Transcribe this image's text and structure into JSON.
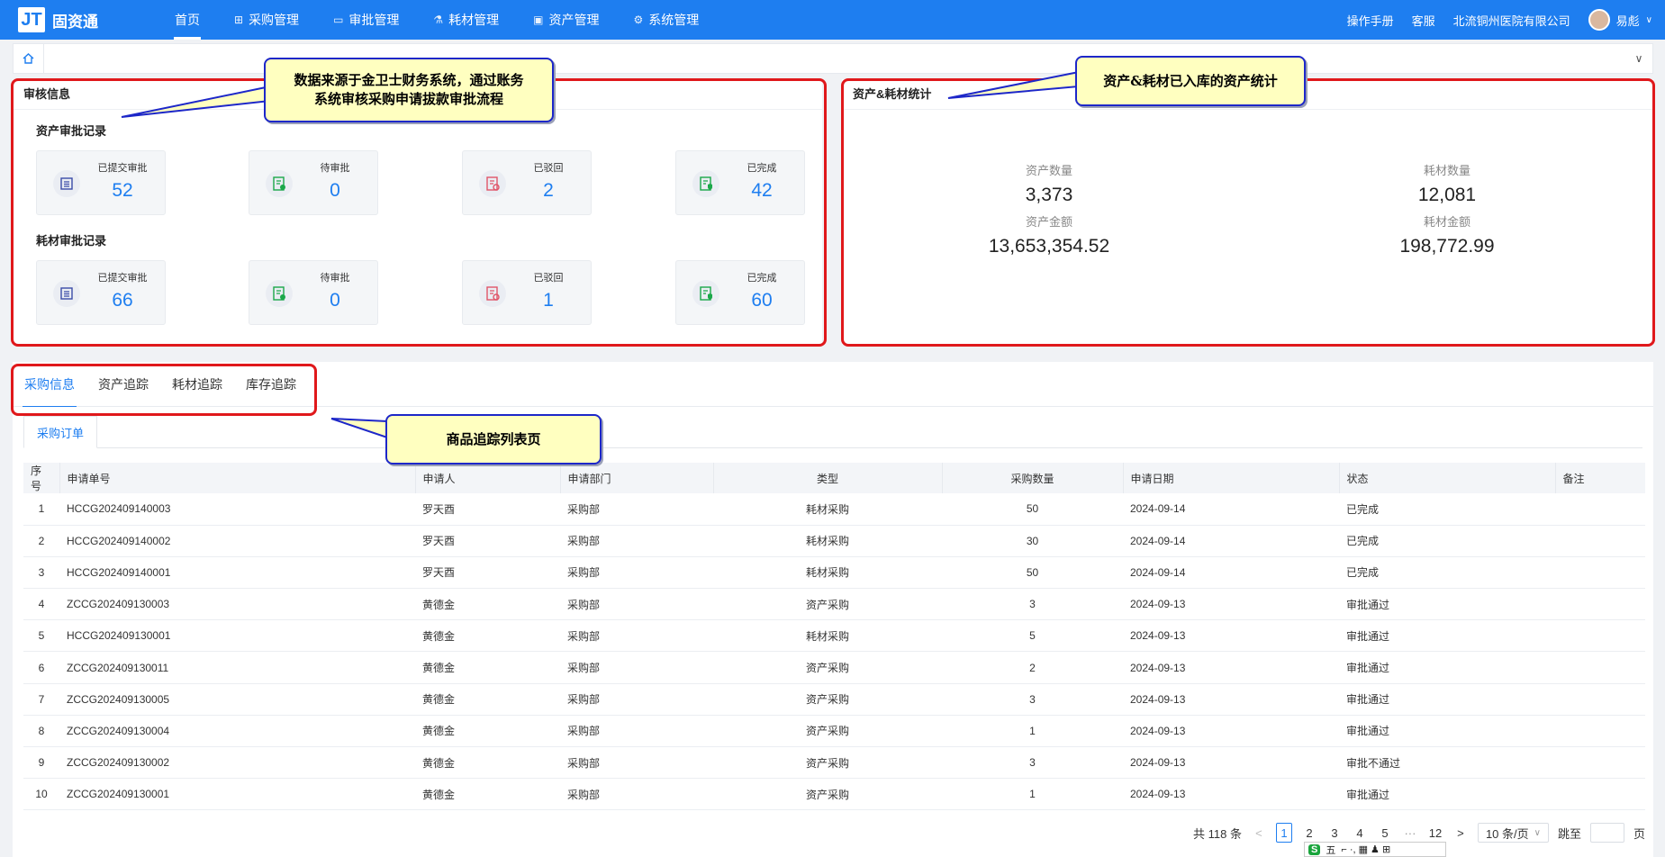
{
  "app": {
    "logo_mark": "JT",
    "name": "固资通"
  },
  "nav": [
    {
      "label": "首页",
      "icon": ""
    },
    {
      "label": "采购管理",
      "icon": "⊞"
    },
    {
      "label": "审批管理",
      "icon": "▭"
    },
    {
      "label": "耗材管理",
      "icon": "⚗"
    },
    {
      "label": "资产管理",
      "icon": "▣"
    },
    {
      "label": "系统管理",
      "icon": "⚙"
    }
  ],
  "topright": {
    "manual": "操作手册",
    "service": "客服",
    "org": "北流铜州医院有限公司",
    "user": "易彪",
    "user_caret": "∨"
  },
  "breadcrumb": {
    "home_icon": "⌂",
    "expand": "∨"
  },
  "audit": {
    "title": "审核信息",
    "asset_title": "资产审批记录",
    "consumable_title": "耗材审批记录",
    "asset_cards": [
      {
        "label": "已提交审批",
        "value": "52"
      },
      {
        "label": "待审批",
        "value": "0"
      },
      {
        "label": "已驳回",
        "value": "2"
      },
      {
        "label": "已完成",
        "value": "42"
      }
    ],
    "consumable_cards": [
      {
        "label": "已提交审批",
        "value": "66"
      },
      {
        "label": "待审批",
        "value": "0"
      },
      {
        "label": "已驳回",
        "value": "1"
      },
      {
        "label": "已完成",
        "value": "60"
      }
    ]
  },
  "stats": {
    "title": "资产&耗材统计",
    "asset_count_label": "资产数量",
    "asset_count": "3,373",
    "asset_amount_label": "资产金额",
    "asset_amount": "13,653,354.52",
    "consumable_count_label": "耗材数量",
    "consumable_count": "12,081",
    "consumable_amount_label": "耗材金额",
    "consumable_amount": "198,772.99"
  },
  "callouts": {
    "audit_line1": "数据来源于金卫士财务系统，通过账务",
    "audit_line2": "系统审核采购申请拔款审批流程",
    "stats": "资产&耗材已入库的资产统计",
    "tabs": "商品追踪列表页"
  },
  "tabs": [
    "采购信息",
    "资产追踪",
    "耗材追踪",
    "库存追踪"
  ],
  "subtab": "采购订单",
  "table": {
    "columns": [
      "序号",
      "申请单号",
      "申请人",
      "申请部门",
      "类型",
      "采购数量",
      "申请日期",
      "状态",
      "备注"
    ],
    "rows": [
      [
        "1",
        "HCCG202409140003",
        "罗天酉",
        "采购部",
        "耗材采购",
        "50",
        "2024-09-14",
        "已完成",
        ""
      ],
      [
        "2",
        "HCCG202409140002",
        "罗天酉",
        "采购部",
        "耗材采购",
        "30",
        "2024-09-14",
        "已完成",
        ""
      ],
      [
        "3",
        "HCCG202409140001",
        "罗天酉",
        "采购部",
        "耗材采购",
        "50",
        "2024-09-14",
        "已完成",
        ""
      ],
      [
        "4",
        "ZCCG202409130003",
        "黄德金",
        "采购部",
        "资产采购",
        "3",
        "2024-09-13",
        "审批通过",
        ""
      ],
      [
        "5",
        "HCCG202409130001",
        "黄德金",
        "采购部",
        "耗材采购",
        "5",
        "2024-09-13",
        "审批通过",
        ""
      ],
      [
        "6",
        "ZCCG202409130011",
        "黄德金",
        "采购部",
        "资产采购",
        "2",
        "2024-09-13",
        "审批通过",
        ""
      ],
      [
        "7",
        "ZCCG202409130005",
        "黄德金",
        "采购部",
        "资产采购",
        "3",
        "2024-09-13",
        "审批通过",
        ""
      ],
      [
        "8",
        "ZCCG202409130004",
        "黄德金",
        "采购部",
        "资产采购",
        "1",
        "2024-09-13",
        "审批通过",
        ""
      ],
      [
        "9",
        "ZCCG202409130002",
        "黄德金",
        "采购部",
        "资产采购",
        "3",
        "2024-09-13",
        "审批不通过",
        ""
      ],
      [
        "10",
        "ZCCG202409130001",
        "黄德金",
        "采购部",
        "资产采购",
        "1",
        "2024-09-13",
        "审批通过",
        ""
      ]
    ]
  },
  "pager": {
    "total": "共 118 条",
    "prev": "<",
    "pages": [
      "1",
      "2",
      "3",
      "4",
      "5"
    ],
    "ellipsis": "···",
    "last": "12",
    "next": ">",
    "size": "10 条/页",
    "size_caret": "∨",
    "goto": "跳至",
    "page_unit": "页"
  },
  "ime": {
    "logo": "S",
    "mode": "五",
    "tools": "⌐ ·, ▦ ♟ ⊞"
  },
  "colors": {
    "primary": "#1e7ef0",
    "annotation_red": "#e0181b",
    "callout_bg": "#ffffc0",
    "callout_border": "#1d27c9"
  }
}
